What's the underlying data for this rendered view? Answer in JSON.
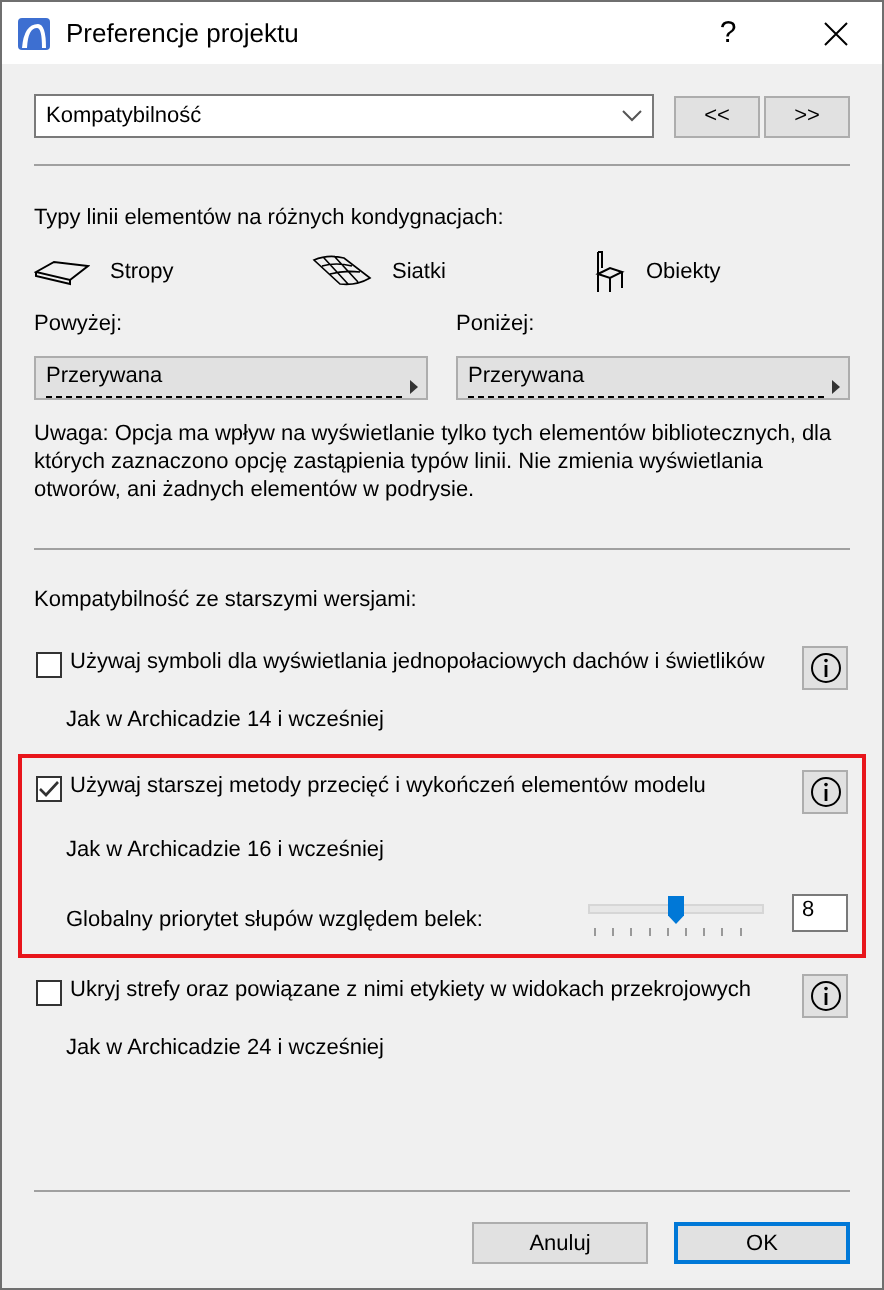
{
  "window": {
    "title": "Preferencje projektu",
    "help": "?"
  },
  "category": {
    "value": "Kompatybilność"
  },
  "nav_buttons": [
    "<<",
    ">>"
  ],
  "line_types": {
    "heading": "Typy linii elementów na różnych kondygnacjach:",
    "element_types": [
      {
        "kind": "slab",
        "label": "Stropy"
      },
      {
        "kind": "mesh",
        "label": "Siatki"
      },
      {
        "kind": "object",
        "label": "Obiekty"
      }
    ],
    "pickers": [
      {
        "label": "Powyżej:",
        "value": "Przerywana"
      },
      {
        "label": "Poniżej:",
        "value": "Przerywana"
      }
    ],
    "note": "Uwaga: Opcja ma wpływ na wyświetlanie tylko tych elementów bibliotecznych, dla których zaznaczono opcję zastąpienia typów linii. Nie zmienia wyświetlania otworów, ani żadnych elementów w podrysie."
  },
  "compatibility": {
    "heading": "Kompatybilność ze starszymi wersjami:",
    "options": [
      {
        "label": "Używaj symboli dla wyświetlania jednopołaciowych dachów i świetlików",
        "checked": false,
        "highlighted": false,
        "note": "Jak w Archicadzie 14 i wcześniej"
      },
      {
        "label": "Używaj starszej metody przecięć i wykończeń elementów modelu",
        "checked": true,
        "highlighted": true,
        "note": "Jak w Archicadzie 16 i wcześniej",
        "slider": {
          "label": "Globalny priorytet słupów względem belek:",
          "level": 0.5,
          "value": "8"
        }
      },
      {
        "label": "Ukryj strefy oraz powiązane z nimi etykiety w widokach przekrojowych",
        "checked": false,
        "highlighted": false,
        "note": "Jak w Archicadzie 24 i wcześniej"
      }
    ]
  },
  "buttons": [
    {
      "label": "Anuluj",
      "default": false
    },
    {
      "label": "OK",
      "default": true
    }
  ]
}
